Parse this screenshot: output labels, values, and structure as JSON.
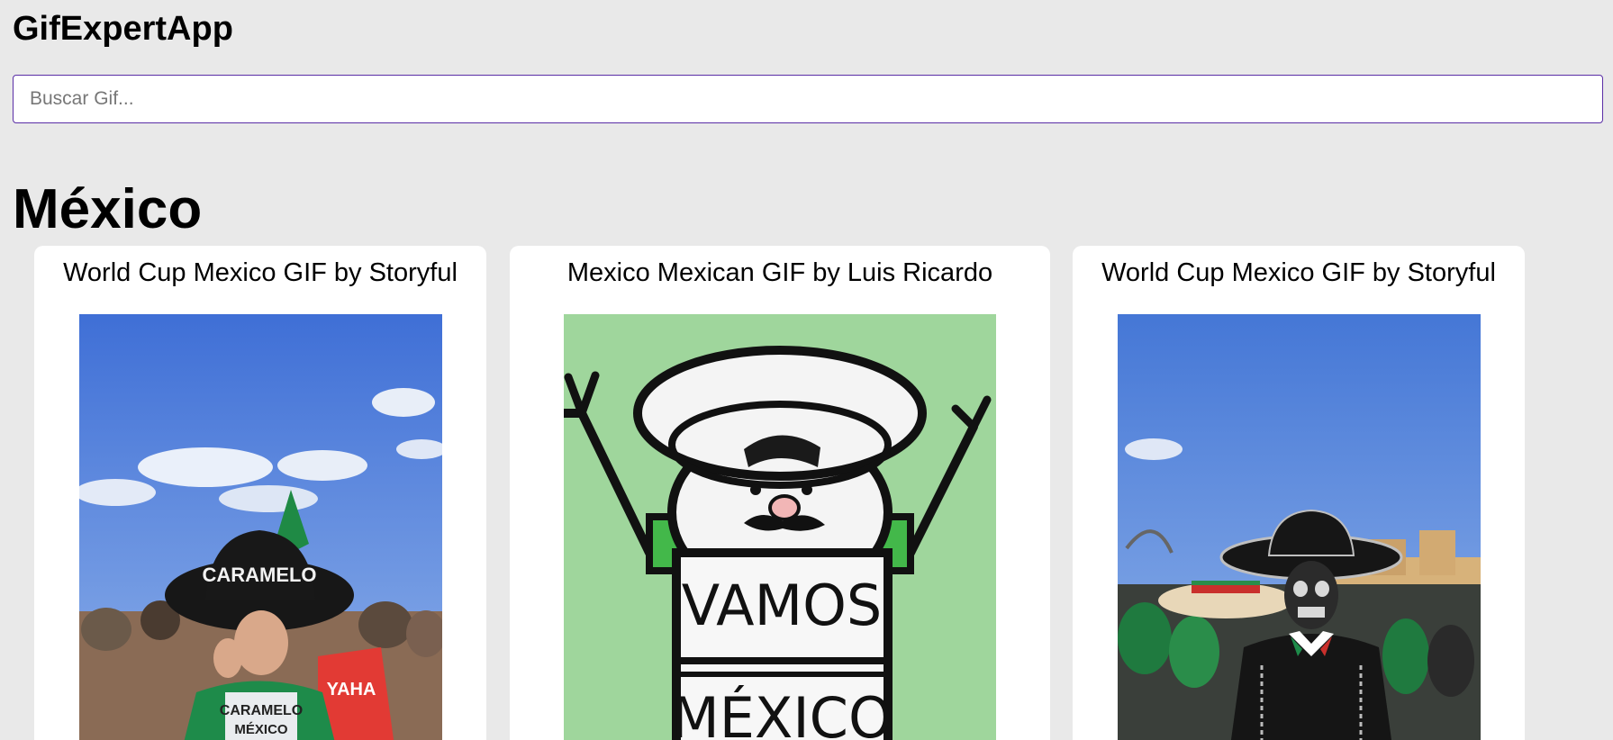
{
  "app": {
    "title": "GifExpertApp"
  },
  "search": {
    "placeholder": "Buscar Gif...",
    "value": ""
  },
  "category": {
    "title": "México",
    "gifs": [
      {
        "title": "World Cup Mexico GIF by Storyful"
      },
      {
        "title": "Mexico Mexican GIF by Luis Ricardo"
      },
      {
        "title": "World Cup Mexico GIF by Storyful"
      }
    ]
  },
  "gif_texts": {
    "hat": "CARAMELO",
    "shirt1": "CARAMELO",
    "shirt2": "MÉXICO",
    "flag": "YAHA",
    "sign1": "VAMOS",
    "sign2": "MÉXICO"
  },
  "colors": {
    "background": "#e9e9e9",
    "card": "#ffffff",
    "search_border": "#5a2ea6",
    "sky": "#5a8ad8",
    "cartoon_bg": "#9fd69c"
  }
}
